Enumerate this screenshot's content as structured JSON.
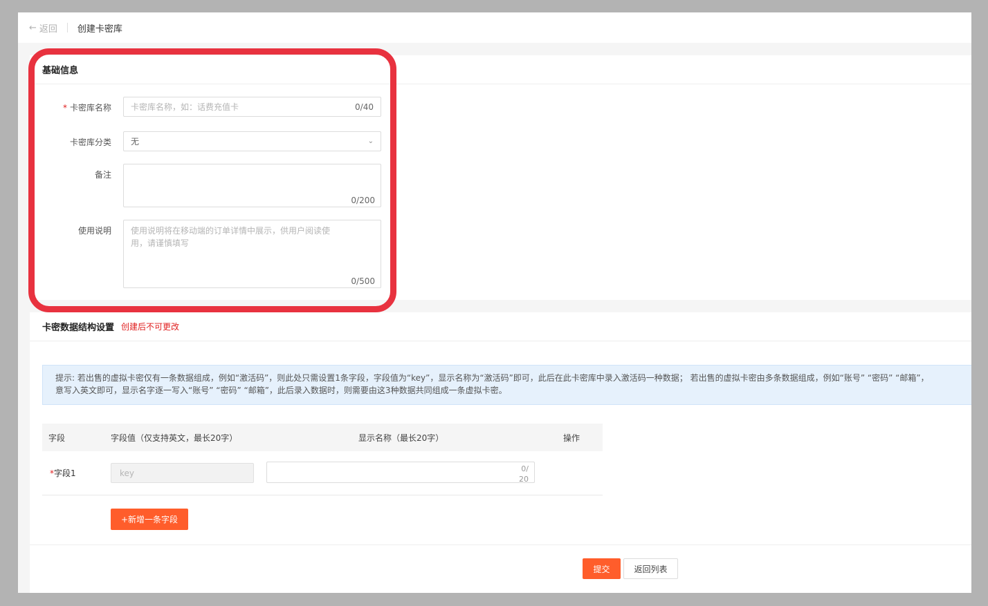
{
  "header": {
    "back_label": "返回",
    "title": "创建卡密库"
  },
  "basic": {
    "title": "基础信息",
    "name": {
      "label": "卡密库名称",
      "placeholder": "卡密库名称，如：话费充值卡",
      "counter": "0/40"
    },
    "category": {
      "label": "卡密库分类",
      "value": "无"
    },
    "remark": {
      "label": "备注",
      "counter": "0/200"
    },
    "usage": {
      "label": "使用说明",
      "placeholder": "使用说明将在移动端的订单详情中展示，供用户阅读使用，请谨慎填写",
      "counter": "0/500"
    }
  },
  "structure": {
    "title": "卡密数据结构设置",
    "note": "创建后不可更改",
    "tip_line1": "提示:  若出售的虚拟卡密仅有一条数据组成，例如“激活码”，则此处只需设置1条字段，字段值为“key”，显示名称为“激活码”即可，此后在此卡密库中录入激活码一种数据；  若出售的虚拟卡密由多条数据组成，例如“账号”  “密码”  “邮箱”，",
    "tip_line2": "意写入英文即可，显示名字逐一写入“账号”  “密码”  “邮箱”，此后录入数据时，则需要由这3种数据共同组成一条虚拟卡密。",
    "table": {
      "headers": [
        "字段",
        "字段值（仅支持英文，最长20字）",
        "显示名称（最长20字）",
        "操作"
      ],
      "rows": [
        {
          "field": "字段1",
          "key_placeholder": "key",
          "name_counter_top": "0/",
          "name_counter_bottom": "20"
        }
      ]
    },
    "add_button": "+新增一条字段"
  },
  "footer": {
    "submit": "提交",
    "back_list": "返回列表"
  },
  "colors": {
    "accent": "#ff5d2b",
    "highlight": "#e8323f",
    "required": "#e02020",
    "tip_bg": "#e6f1fc"
  }
}
